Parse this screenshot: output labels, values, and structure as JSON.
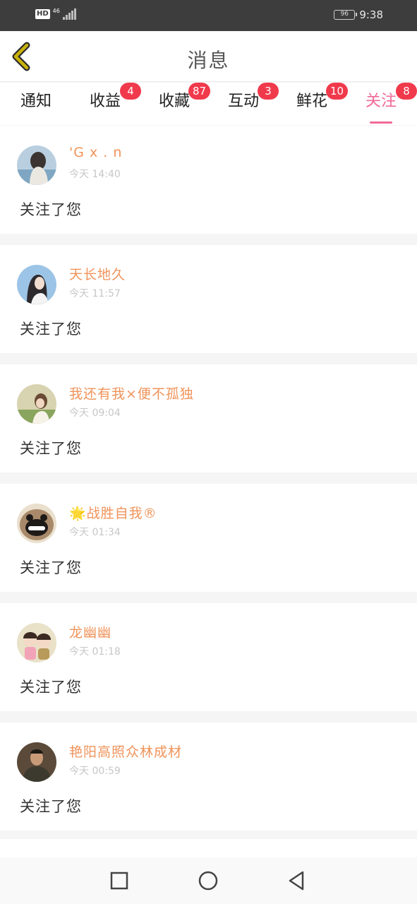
{
  "status_bar": {
    "hd": "HD",
    "network": "46",
    "battery": "96",
    "time": "9:38"
  },
  "header": {
    "title": "消息",
    "back_icon": "chevron-left-icon",
    "back_icon_color": "#c8b20a"
  },
  "tabs": [
    {
      "label": "通知",
      "badge": ""
    },
    {
      "label": "收益",
      "badge": "4"
    },
    {
      "label": "收藏",
      "badge": "87"
    },
    {
      "label": "互动",
      "badge": "3"
    },
    {
      "label": "鲜花",
      "badge": "10"
    },
    {
      "label": "关注",
      "badge": "8",
      "active": true
    }
  ],
  "colors": {
    "accent": "#f06a96",
    "username": "#f0935a",
    "badge": "#f03a4c"
  },
  "notifications": [
    {
      "username": "'G x . n",
      "time": "今天 14:40",
      "message": "关注了您",
      "avatar": "avatar-photo-icon"
    },
    {
      "username": "天长地久",
      "time": "今天 11:57",
      "message": "关注了您",
      "avatar": "avatar-photo-icon"
    },
    {
      "username": "我还有我×便不孤独",
      "time": "今天 09:04",
      "message": "关注了您",
      "avatar": "avatar-photo-icon"
    },
    {
      "username": "🌟战胜自我®",
      "time": "今天 01:34",
      "message": "关注了您",
      "avatar": "avatar-pug-icon"
    },
    {
      "username": "龙幽幽",
      "time": "今天 01:18",
      "message": "关注了您",
      "avatar": "avatar-cartoon-icon"
    },
    {
      "username": "艳阳高照众林成材",
      "time": "今天 00:59",
      "message": "关注了您",
      "avatar": "avatar-photo-icon"
    }
  ],
  "nav_bar": {
    "recent_icon": "square-icon",
    "home_icon": "circle-icon",
    "back_icon": "triangle-back-icon"
  }
}
